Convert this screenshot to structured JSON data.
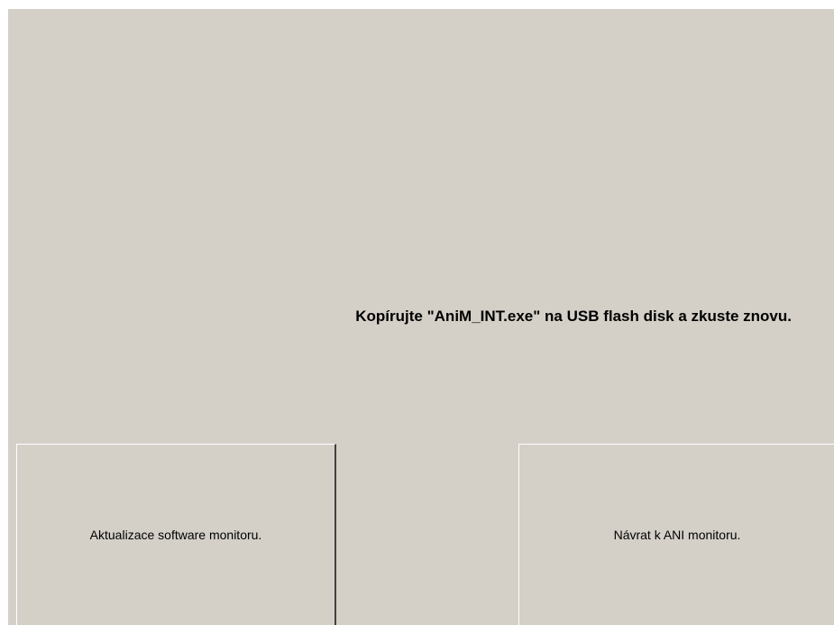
{
  "message": "Kopírujte \"AniM_INT.exe\" na USB flash disk a zkuste znovu.",
  "buttons": {
    "update_label": "Aktualizace software monitoru.",
    "return_label": "Návrat k ANI monitoru."
  },
  "colors": {
    "background": "#d4d0c8",
    "text": "#000000"
  }
}
